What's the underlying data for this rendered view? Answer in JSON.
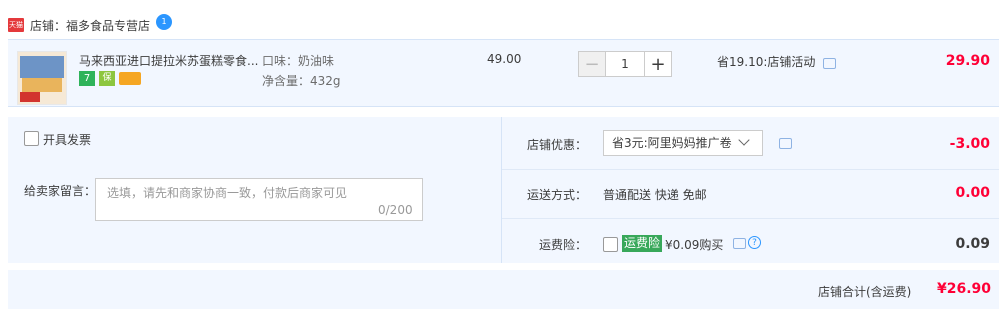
{
  "shop": {
    "badge": "天猫",
    "name": "店铺：福多食品专营店",
    "chat_badge": "1"
  },
  "item": {
    "title": "马来西亚进口提拉米苏蛋糕零食...",
    "service_icons": [
      "7",
      "保"
    ],
    "sku_flavor": "口味：奶油味",
    "sku_weight": "净含量：432g",
    "unit_price": "49.00",
    "quantity": "1",
    "minus": "−",
    "plus": "+",
    "promo": "省19.10:店铺活动",
    "total": "29.90"
  },
  "invoice": {
    "label": "开具发票"
  },
  "note": {
    "label": "给卖家留言：",
    "placeholder": "选填，请先和商家协商一致，付款后商家可见",
    "counter": "0/200"
  },
  "discount": {
    "label": "店铺优惠：",
    "selected": "省3元:阿里妈妈推广卷",
    "value": "-3.00"
  },
  "shipping": {
    "label": "运送方式：",
    "method": "普通配送 快递 免邮",
    "value": "0.00"
  },
  "insurance": {
    "label": "运费险：",
    "tag": "运费险",
    "price_text": "¥0.09购买",
    "value": "0.09"
  },
  "footer": {
    "label": "店铺合计(含运费)",
    "total": "¥26.90"
  }
}
